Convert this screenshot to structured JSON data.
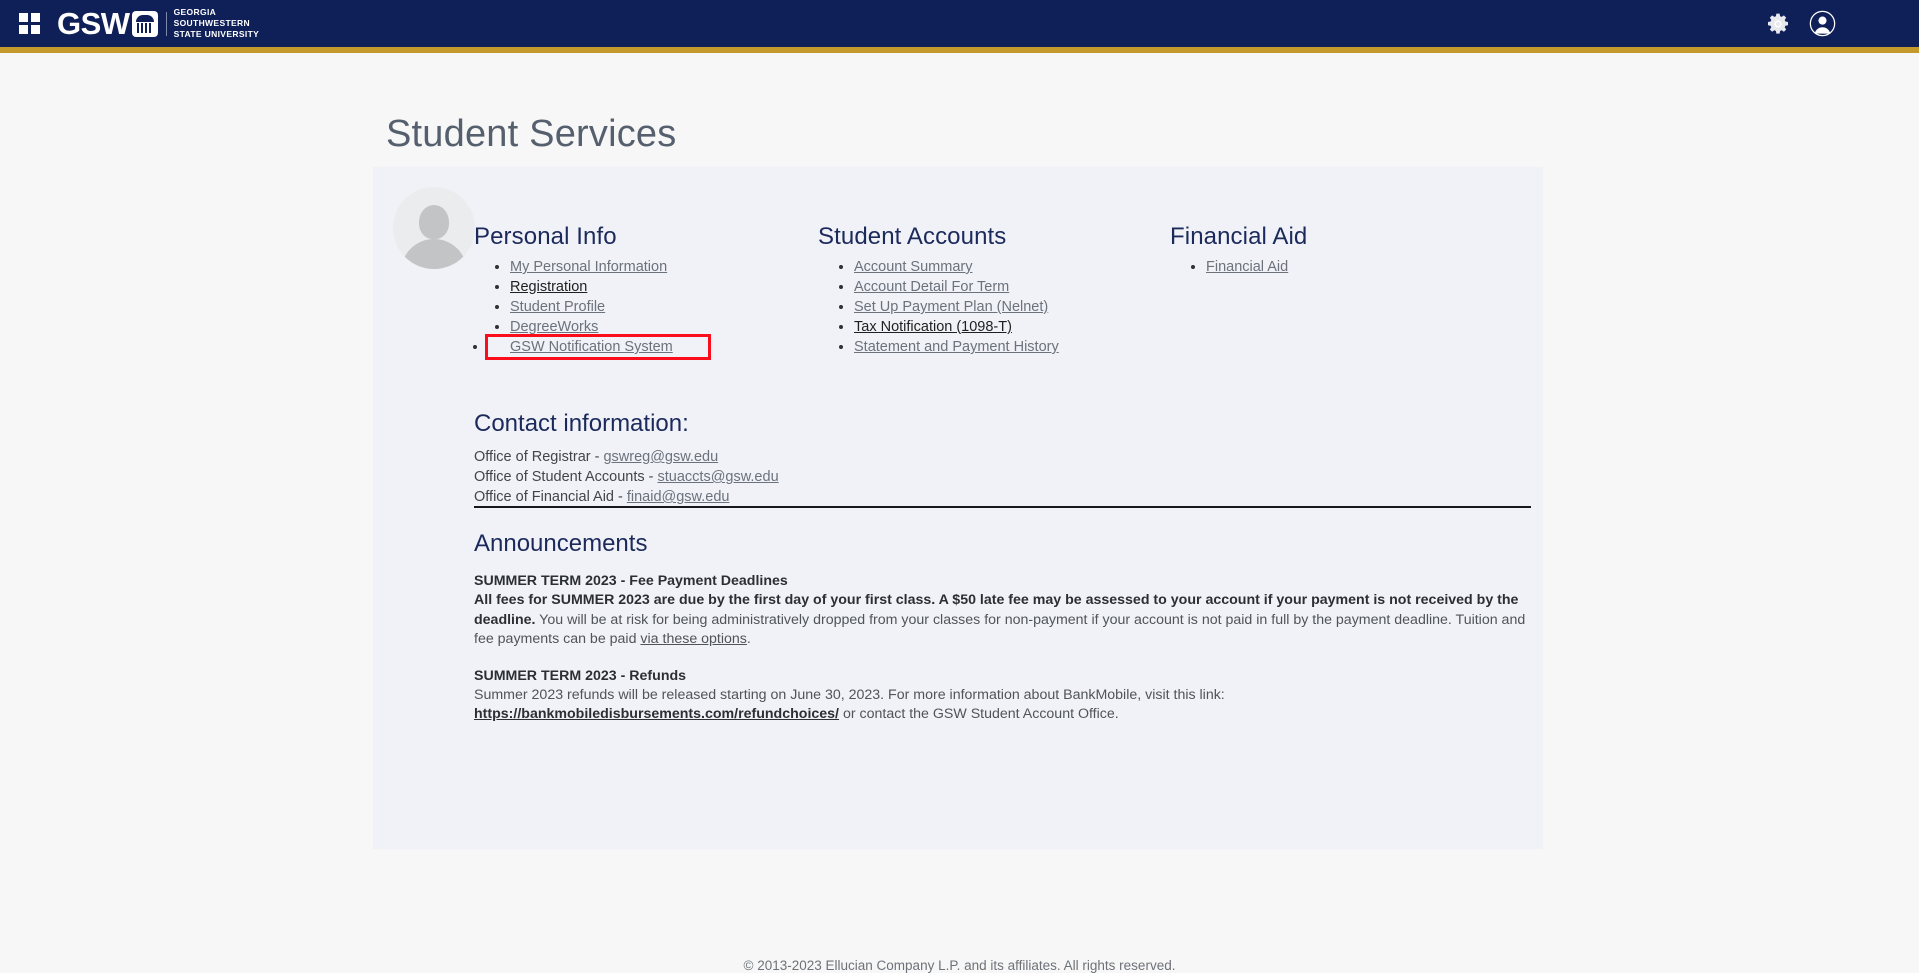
{
  "navbar": {
    "grid_icon": "apps-grid-icon",
    "brand_word": "GSW",
    "brand_line1": "GEORGIA",
    "brand_line2": "SOUTHWESTERN",
    "brand_line3": "STATE UNIVERSITY",
    "gear_icon": "gear-icon",
    "profile_icon": "user-avatar-icon"
  },
  "page": {
    "title": "Student Services"
  },
  "columns": [
    {
      "heading": "Personal Info",
      "links": [
        {
          "label": "My Personal Information",
          "strong": false,
          "highlighted": false
        },
        {
          "label": "Registration",
          "strong": true,
          "highlighted": false
        },
        {
          "label": "Student Profile",
          "strong": false,
          "highlighted": false
        },
        {
          "label": "DegreeWorks",
          "strong": false,
          "highlighted": false
        },
        {
          "label": "GSW Notification System",
          "strong": false,
          "highlighted": true
        }
      ]
    },
    {
      "heading": "Student Accounts",
      "links": [
        {
          "label": "Account Summary",
          "strong": false,
          "highlighted": false
        },
        {
          "label": "Account Detail For Term",
          "strong": false,
          "highlighted": false
        },
        {
          "label": "Set Up Payment Plan (Nelnet)",
          "strong": false,
          "highlighted": false
        },
        {
          "label": "Tax Notification (1098-T)",
          "strong": true,
          "highlighted": false
        },
        {
          "label": "Statement and Payment History",
          "strong": false,
          "highlighted": false
        }
      ]
    },
    {
      "heading": "Financial Aid",
      "links": [
        {
          "label": "Financial Aid",
          "strong": false,
          "highlighted": false
        }
      ]
    }
  ],
  "contact": {
    "heading": "Contact information:",
    "lines": [
      {
        "prefix": "Office of Registrar - ",
        "email": "gswreg@gsw.edu"
      },
      {
        "prefix": "Office of Student Accounts - ",
        "email": "stuaccts@gsw.edu"
      },
      {
        "prefix": "Office of Financial Aid - ",
        "email": "finaid@gsw.edu"
      }
    ]
  },
  "announcements": {
    "heading": "Announcements",
    "items": [
      {
        "title": "SUMMER TERM 2023 - Fee Payment Deadlines",
        "bold_text": "All fees for SUMMER 2023 are due by the first day of your first class. A $50 late fee may be assessed to your account if your payment is not received by the deadline.",
        "normal_text": " You will be at risk for being administratively dropped from your classes for non-payment if your account is not paid in full by the payment deadline. Tuition and fee payments can be paid ",
        "link_text": "via these options",
        "tail_text": "."
      },
      {
        "title": "SUMMER TERM 2023 - Refunds",
        "bold_text": "",
        "normal_text": "Summer 2023 refunds will be released starting on June 30, 2023. For more information about BankMobile, visit this link: ",
        "link_text": "https://bankmobiledisbursements.com/refundchoices/",
        "tail_text": " or contact the GSW Student Account Office."
      }
    ]
  },
  "footer": {
    "copyright": "© 2013-2023 Ellucian Company L.P. and its affiliates. All rights reserved."
  },
  "colors": {
    "navy": "#0f2058",
    "gold": "#c49a2c",
    "page_bg": "#f7f7f7",
    "card_bg": "#f1f2f7",
    "heading_blue": "#1b2a5b",
    "link_gray": "#6b727c",
    "highlight_red": "#fc0d1b"
  }
}
